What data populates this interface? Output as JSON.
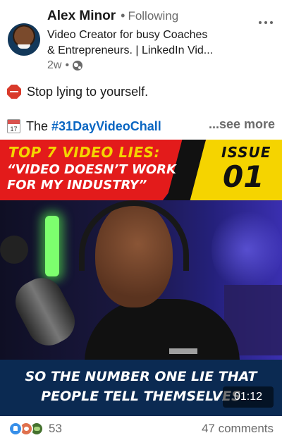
{
  "author": {
    "name": "Alex Minor",
    "relation_separator": "•",
    "relation": "Following",
    "headline_line1": "Video Creator for busy Coaches",
    "headline_line2": "& Entrepreneurs. | LinkedIn Vid...",
    "posted_ago": "2w",
    "meta_separator": "•",
    "visibility_icon": "globe-icon"
  },
  "post": {
    "line1_icon": "stop-sign-icon",
    "line1_text": "Stop lying to yourself.",
    "line2_icon": "calendar-icon",
    "line2_calendar_day": "17",
    "line2_text": "The",
    "line2_hashtag": "#31DayVideoChall",
    "see_more": "...see more"
  },
  "video": {
    "banner_title": "TOP 7 VIDEO LIES:",
    "banner_quote_line1": "“VIDEO DOESN’T WORK",
    "banner_quote_line2": "FOR MY INDUSTRY”",
    "issue_label": "ISSUE",
    "issue_number": "01",
    "caption_line1": "SO THE NUMBER ONE LIE THAT",
    "caption_line2": "PEOPLE TELL THEMSELVES",
    "duration": "01:12"
  },
  "social": {
    "reaction_icons": [
      "like-icon",
      "love-icon",
      "support-icon"
    ],
    "reaction_count": "53",
    "comments": "47 comments"
  },
  "colors": {
    "link_blue": "#0a66c2",
    "banner_red": "#e31b1b",
    "banner_yellow": "#f5d400",
    "caption_bar": "#0b2a52"
  }
}
